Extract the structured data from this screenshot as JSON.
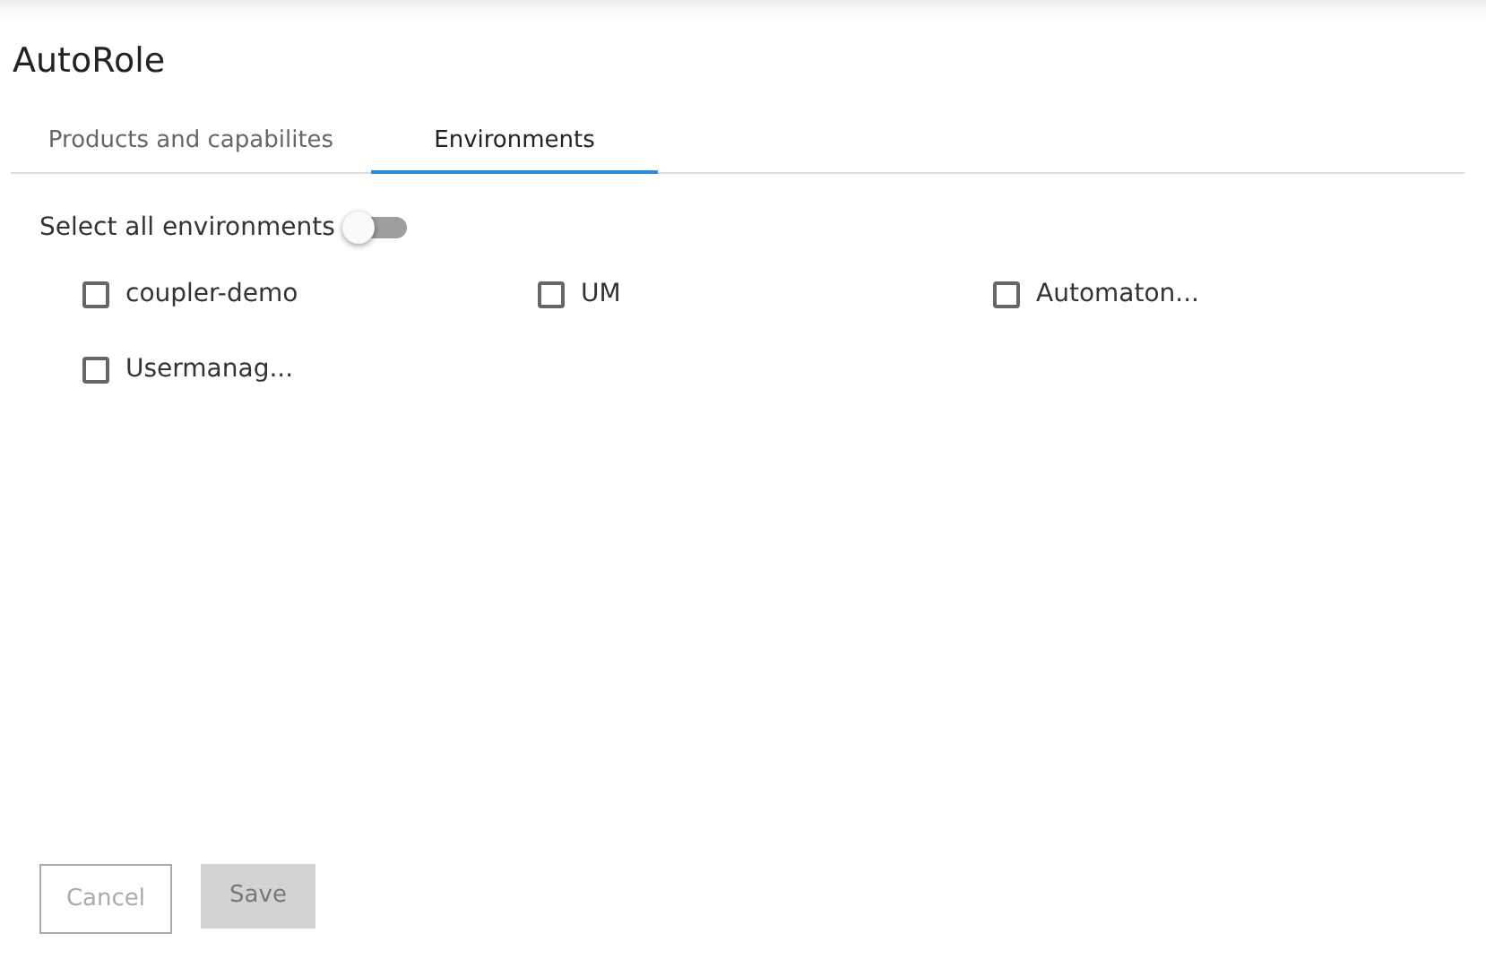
{
  "title": "AutoRole",
  "tabs": [
    {
      "label": "Products and capabilites",
      "selected": false
    },
    {
      "label": "Environments",
      "selected": true
    }
  ],
  "select_all": {
    "label": "Select all environments",
    "on": false
  },
  "environments": [
    {
      "label": "coupler-demo",
      "checked": false
    },
    {
      "label": "UM",
      "checked": false
    },
    {
      "label": "Automaton...",
      "checked": false
    },
    {
      "label": "Usermanag...",
      "checked": false
    }
  ],
  "buttons": [
    {
      "label": "Cancel",
      "kind": "outline",
      "disabled": true
    },
    {
      "label": "Save",
      "kind": "filled",
      "disabled": true
    }
  ]
}
